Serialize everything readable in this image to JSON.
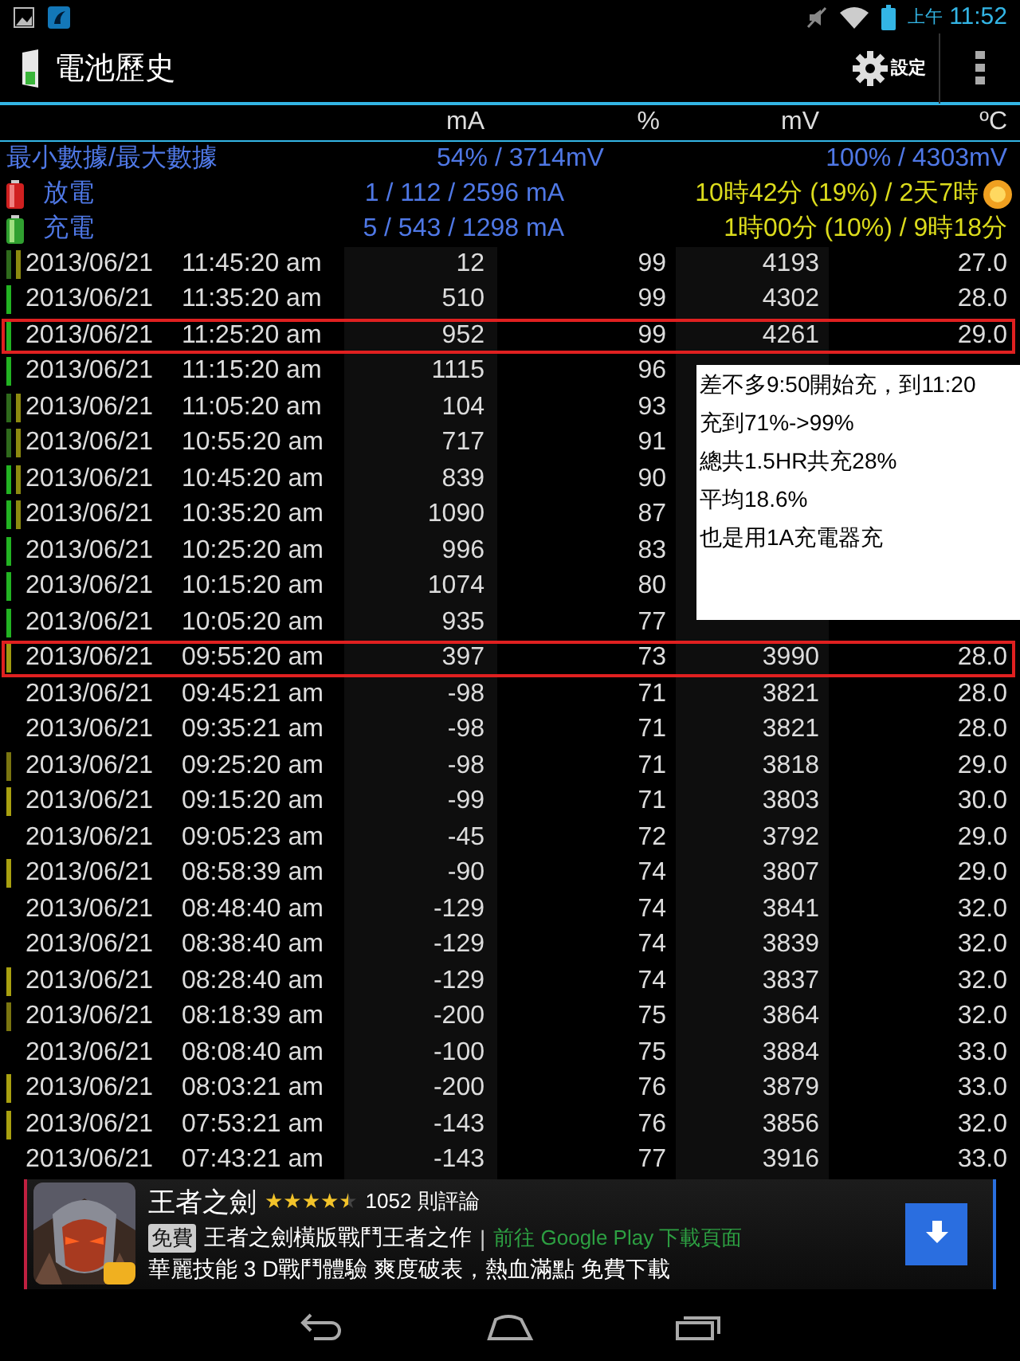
{
  "status_bar": {
    "am_pm": "上午",
    "time": "11:52"
  },
  "action_bar": {
    "title": "電池歷史",
    "settings_label": "設定"
  },
  "columns": {
    "current": "mA",
    "percent": "%",
    "voltage": "mV",
    "temperature": "ºC"
  },
  "summary": [
    {
      "kind": "range",
      "label": "最小數據/最大數據",
      "value_1": "54% / 3714mV",
      "value_2": "100% / 4303mV"
    },
    {
      "kind": "discharge",
      "label": "放電",
      "value_1": "1 / 112 / 2596 mA",
      "value_2": "10時42分 (19%) / 2天7時"
    },
    {
      "kind": "charge",
      "label": "充電",
      "value_1": "5 / 543 / 1298 mA",
      "value_2": "1時00分 (10%) / 9時18分"
    }
  ],
  "rows": [
    {
      "date": "2013/06/21",
      "time": "11:45:20 am",
      "ma": "12",
      "pct": "99",
      "mv": "4193",
      "temp": "27.0",
      "highlighted": false,
      "bars": [
        {
          "color": "#2f6a1c"
        },
        {
          "color": "#8c8a10"
        }
      ]
    },
    {
      "date": "2013/06/21",
      "time": "11:35:20 am",
      "ma": "510",
      "pct": "99",
      "mv": "4302",
      "temp": "28.0",
      "highlighted": false,
      "bars": [
        {
          "color": "#22b322"
        }
      ]
    },
    {
      "date": "2013/06/21",
      "time": "11:25:20 am",
      "ma": "952",
      "pct": "99",
      "mv": "4261",
      "temp": "29.0",
      "highlighted": true,
      "bars": [
        {
          "color": "#22b322"
        }
      ]
    },
    {
      "date": "2013/06/21",
      "time": "11:15:20 am",
      "ma": "1115",
      "pct": "96",
      "highlighted": false,
      "bars": [
        {
          "color": "#22b322"
        }
      ]
    },
    {
      "date": "2013/06/21",
      "time": "11:05:20 am",
      "ma": "104",
      "pct": "93",
      "highlighted": false,
      "bars": [
        {
          "color": "#2f6a1c"
        },
        {
          "color": "#8c8a10"
        }
      ]
    },
    {
      "date": "2013/06/21",
      "time": "10:55:20 am",
      "ma": "717",
      "pct": "91",
      "highlighted": false,
      "bars": [
        {
          "color": "#2f6a1c"
        },
        {
          "color": "#8c8a10"
        }
      ]
    },
    {
      "date": "2013/06/21",
      "time": "10:45:20 am",
      "ma": "839",
      "pct": "90",
      "highlighted": false,
      "bars": [
        {
          "color": "#22b322"
        },
        {
          "color": "#8c8a10"
        }
      ]
    },
    {
      "date": "2013/06/21",
      "time": "10:35:20 am",
      "ma": "1090",
      "pct": "87",
      "highlighted": false,
      "bars": [
        {
          "color": "#22b322"
        },
        {
          "color": "#8c8a10"
        }
      ]
    },
    {
      "date": "2013/06/21",
      "time": "10:25:20 am",
      "ma": "996",
      "pct": "83",
      "highlighted": false,
      "bars": [
        {
          "color": "#22b322"
        }
      ]
    },
    {
      "date": "2013/06/21",
      "time": "10:15:20 am",
      "ma": "1074",
      "pct": "80",
      "highlighted": false,
      "bars": [
        {
          "color": "#22b322"
        }
      ]
    },
    {
      "date": "2013/06/21",
      "time": "10:05:20 am",
      "ma": "935",
      "pct": "77",
      "highlighted": false,
      "bars": [
        {
          "color": "#22b322"
        }
      ]
    },
    {
      "date": "2013/06/21",
      "time": "09:55:20 am",
      "ma": "397",
      "pct": "73",
      "mv": "3990",
      "temp": "28.0",
      "highlighted": true,
      "bars": [
        {
          "color": "#a09a10"
        }
      ]
    },
    {
      "date": "2013/06/21",
      "time": "09:45:21 am",
      "ma": "-98",
      "pct": "71",
      "mv": "3821",
      "temp": "28.0",
      "highlighted": false,
      "bars": []
    },
    {
      "date": "2013/06/21",
      "time": "09:35:21 am",
      "ma": "-98",
      "pct": "71",
      "mv": "3821",
      "temp": "28.0",
      "highlighted": false,
      "bars": []
    },
    {
      "date": "2013/06/21",
      "time": "09:25:20 am",
      "ma": "-98",
      "pct": "71",
      "mv": "3818",
      "temp": "29.0",
      "highlighted": false,
      "bars": [
        {
          "color": "#7a7510"
        }
      ]
    },
    {
      "date": "2013/06/21",
      "time": "09:15:20 am",
      "ma": "-99",
      "pct": "71",
      "mv": "3803",
      "temp": "30.0",
      "highlighted": false,
      "bars": [
        {
          "color": "#a8a010"
        }
      ]
    },
    {
      "date": "2013/06/21",
      "time": "09:05:23 am",
      "ma": "-45",
      "pct": "72",
      "mv": "3792",
      "temp": "29.0",
      "highlighted": false,
      "bars": []
    },
    {
      "date": "2013/06/21",
      "time": "08:58:39 am",
      "ma": "-90",
      "pct": "74",
      "mv": "3807",
      "temp": "29.0",
      "highlighted": false,
      "bars": [
        {
          "color": "#a8a010"
        }
      ]
    },
    {
      "date": "2013/06/21",
      "time": "08:48:40 am",
      "ma": "-129",
      "pct": "74",
      "mv": "3841",
      "temp": "32.0",
      "highlighted": false,
      "bars": []
    },
    {
      "date": "2013/06/21",
      "time": "08:38:40 am",
      "ma": "-129",
      "pct": "74",
      "mv": "3839",
      "temp": "32.0",
      "highlighted": false,
      "bars": []
    },
    {
      "date": "2013/06/21",
      "time": "08:28:40 am",
      "ma": "-129",
      "pct": "74",
      "mv": "3837",
      "temp": "32.0",
      "highlighted": false,
      "bars": [
        {
          "color": "#a8a010"
        }
      ]
    },
    {
      "date": "2013/06/21",
      "time": "08:18:39 am",
      "ma": "-200",
      "pct": "75",
      "mv": "3864",
      "temp": "32.0",
      "highlighted": false,
      "bars": [
        {
          "color": "#7a7510"
        }
      ]
    },
    {
      "date": "2013/06/21",
      "time": "08:08:40 am",
      "ma": "-100",
      "pct": "75",
      "mv": "3884",
      "temp": "33.0",
      "highlighted": false,
      "bars": []
    },
    {
      "date": "2013/06/21",
      "time": "08:03:21 am",
      "ma": "-200",
      "pct": "76",
      "mv": "3879",
      "temp": "33.0",
      "highlighted": false,
      "bars": [
        {
          "color": "#a8a010"
        }
      ]
    },
    {
      "date": "2013/06/21",
      "time": "07:53:21 am",
      "ma": "-143",
      "pct": "76",
      "mv": "3856",
      "temp": "32.0",
      "highlighted": false,
      "bars": [
        {
          "color": "#a8a010"
        }
      ]
    },
    {
      "date": "2013/06/21",
      "time": "07:43:21 am",
      "ma": "-143",
      "pct": "77",
      "mv": "3916",
      "temp": "33.0",
      "highlighted": false,
      "bars": []
    }
  ],
  "note": [
    "差不多9:50開始充，到11:20",
    "充到71%->99%",
    "總共1.5HR共充28%",
    "平均18.6%",
    "也是用1A充電器充"
  ],
  "ad": {
    "title": "王者之劍",
    "stars": 4.5,
    "reviews": "1052 則評論",
    "badge": "免費",
    "description": "王者之劍橫版戰鬥王者之作",
    "separator": "|",
    "link": "前往 Google Play 下載頁面",
    "tagline": "華麗技能 3 D戰鬥體驗 爽度破表，熱血滿點 免費下載"
  }
}
